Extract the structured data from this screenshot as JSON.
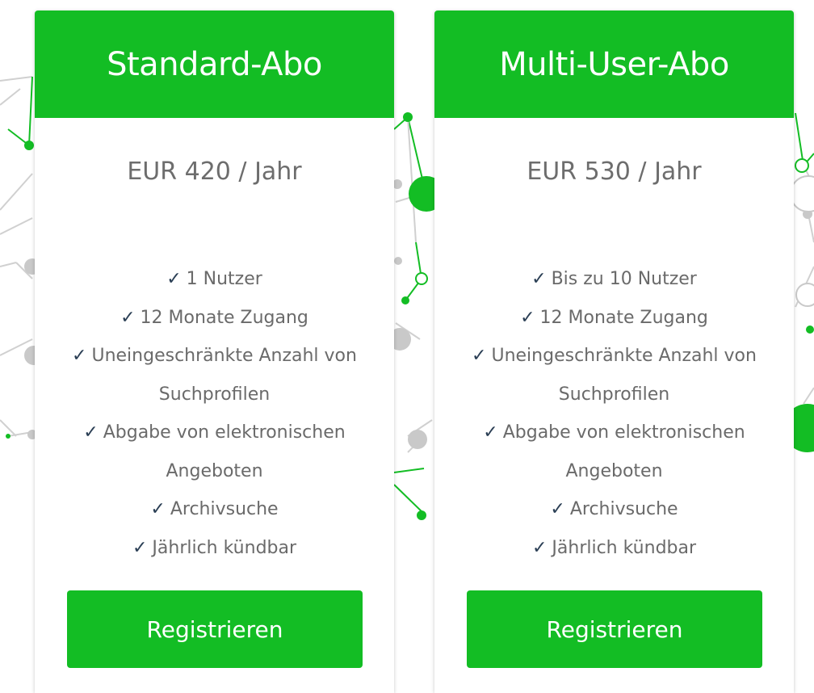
{
  "colors": {
    "accent": "#13bd24",
    "check": "#2b3f55",
    "text": "#6a6a6a",
    "network_line": "#d0d0d0",
    "network_node": "#c9c9c9"
  },
  "icons": {
    "feature_marker": "check-icon",
    "glyph": "✓"
  },
  "plans": [
    {
      "title": "Standard-Abo",
      "price": "EUR 420 / Jahr",
      "features": [
        {
          "text": "1 Nutzer"
        },
        {
          "text": "12 Monate Zugang"
        },
        {
          "text": "Uneingeschränkte Anzahl von Suchprofilen"
        },
        {
          "text": "Abgabe von elektronischen Angeboten"
        },
        {
          "text": "Archivsuche"
        },
        {
          "text": "Jährlich kündbar"
        }
      ],
      "button_label": "Registrieren"
    },
    {
      "title": "Multi-User-Abo",
      "price": "EUR 530 / Jahr",
      "features": [
        {
          "text": "Bis zu 10 Nutzer"
        },
        {
          "text": "12 Monate Zugang"
        },
        {
          "text": "Uneingeschränkte Anzahl von Suchprofilen"
        },
        {
          "text": "Abgabe von elektronischen Angeboten"
        },
        {
          "text": "Archivsuche"
        },
        {
          "text": "Jährlich kündbar"
        }
      ],
      "button_label": "Registrieren"
    }
  ]
}
